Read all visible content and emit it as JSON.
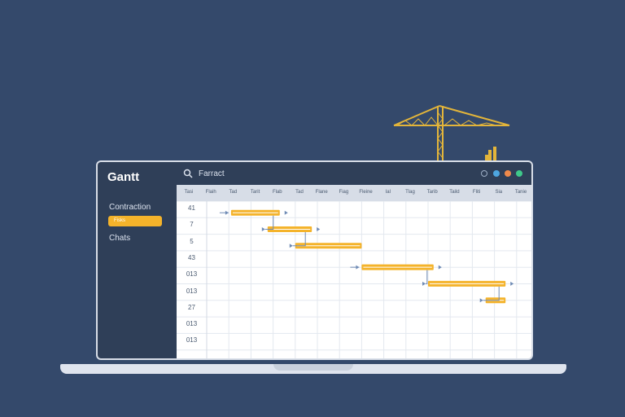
{
  "colors": {
    "background": "#34496b",
    "sidebar": "#2f3f58",
    "accent": "#f4b32b",
    "header": "#d7dde7"
  },
  "app": {
    "brand": "Gantt"
  },
  "sidebar": {
    "items": [
      {
        "label": "Contraction",
        "active": false
      },
      {
        "label": "Fisks",
        "active": true
      },
      {
        "label": "Chats",
        "active": false
      }
    ]
  },
  "search": {
    "value": "Farract",
    "icon": "search-icon"
  },
  "window_controls": [
    "settings-icon",
    "status-blue",
    "status-orange",
    "status-green"
  ],
  "timeline": {
    "headers": [
      "Tasi",
      "Flaih",
      "Tad",
      "Tarit",
      "Flab",
      "Tad",
      "Flane",
      "Fiag",
      "Fleine",
      "Ial",
      "Tlag",
      "Tarib",
      "Taild",
      "Fliti",
      "Sia",
      "Tanie"
    ]
  },
  "rows": [
    "41",
    "7",
    "5",
    "43",
    "013",
    "013",
    "27",
    "013",
    "013"
  ],
  "tasks": [
    {
      "row": 0,
      "start": 2.2,
      "end": 6.6,
      "dep_from": "left"
    },
    {
      "row": 1,
      "start": 5.5,
      "end": 9.5,
      "dep_from": 0
    },
    {
      "row": 2,
      "start": 8.0,
      "end": 14.0,
      "dep_from": 1
    },
    {
      "row": 3,
      "start": 14.0,
      "end": 20.5,
      "dep_from": "left"
    },
    {
      "row": 4,
      "start": 20.0,
      "end": 27.0,
      "dep_from": 3
    },
    {
      "row": 5,
      "start": 25.2,
      "end": 27.0,
      "dep_from": 4
    }
  ]
}
